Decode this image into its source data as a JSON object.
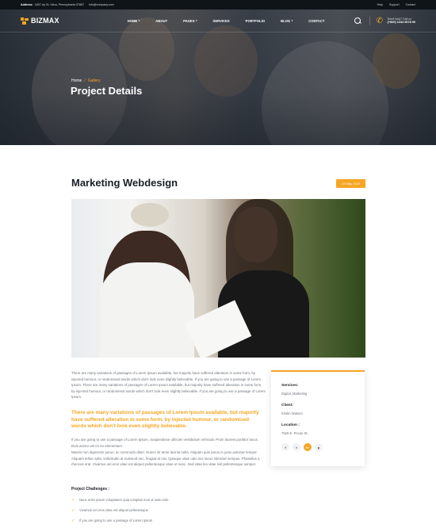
{
  "topbar": {
    "address_label": "Address:",
    "address": "1857 Ivy St. Utica, Pennsylvania 57867",
    "email": "info@company.com",
    "links": [
      "Help",
      "Support",
      "Contact"
    ]
  },
  "brand": {
    "name": "BIZMAX",
    "accent": "#f5a623"
  },
  "nav": {
    "items": [
      {
        "label": "HOME",
        "dropdown": true
      },
      {
        "label": "ABOUT",
        "dropdown": false
      },
      {
        "label": "PAGES",
        "dropdown": true
      },
      {
        "label": "SERVICES",
        "dropdown": false
      },
      {
        "label": "PORTFOLIO",
        "dropdown": false
      },
      {
        "label": "BLOG",
        "dropdown": true
      },
      {
        "label": "CONTACT",
        "dropdown": false
      }
    ],
    "help_label": "Need help? Call us",
    "help_phone": "(+800) 1234 5678 90"
  },
  "hero": {
    "breadcrumb": {
      "home": "Home",
      "separator": "/",
      "current": "Gallery"
    },
    "title": "Project Details"
  },
  "project": {
    "title": "Marketing Webdesign",
    "date": "23 May, 2023",
    "paragraph1": "There are many variations of passages of Lorem Ipsum available, but majority have suffered alteration in some form, by injected humour, or randomised words which don't look even slightly believable. If you are going to use a passage of Lorem Ipsum. There are many variations of passages of Lorem Ipsum available, but majority have suffered alteration in some form, by injected humour, or randomised words which don't look even slightly believable. If you are going to use a passage of Lorem Ipsum.",
    "highlight": "There are many variations of passages of Lorem Ipsum available, but majority have suffered alteration in some form, by injected humour, or randomised words which don't look even slightly believable.",
    "paragraph2": "If you are going to use a passage of Lorem Ipsum. Suspendisse ultricies vestibulum vehicula. Proin laoreet porttitor lacus. Duis auctor vel ex eu elementum.",
    "paragraph3": "Mauris non dignissim purus, ac commodo diam. Donec sit amet lacinia nulla. Aliquam quis purus in justo pulvinar tempor. Aliquam tellus nulla, sollicitudin at euismod nec, feugiat at nisi. Quisque vitae odio nec lacus interdum tempus. Phasellus a rhoncus erat. Vivamus vel eros vitae est aliquet pellentesque vitae et nunc. Sed vitae leo vitae nisl pellentesque semper.",
    "challenges_title": "Project Challenges :",
    "challenges": [
      "Nunc enim ipsum voluptatem quia voluptas mus ut iusto sole.",
      "Vivamus vel eros vitae est aliquet pellentesque",
      "If you are going to use a passage of Lorem Ipsum"
    ]
  },
  "info": {
    "services_label": "Services:",
    "services": "Digital, Marketing",
    "client_label": "Client:",
    "client": "Kristin Watson",
    "location_label": "Location :",
    "location": "7529 E. Pecan St.",
    "socials": [
      {
        "icon": "facebook-icon",
        "glyph": "f"
      },
      {
        "icon": "twitter-icon",
        "glyph": "t"
      },
      {
        "icon": "linkedin-icon",
        "glyph": "in"
      },
      {
        "icon": "pinterest-icon",
        "glyph": "p"
      }
    ]
  }
}
